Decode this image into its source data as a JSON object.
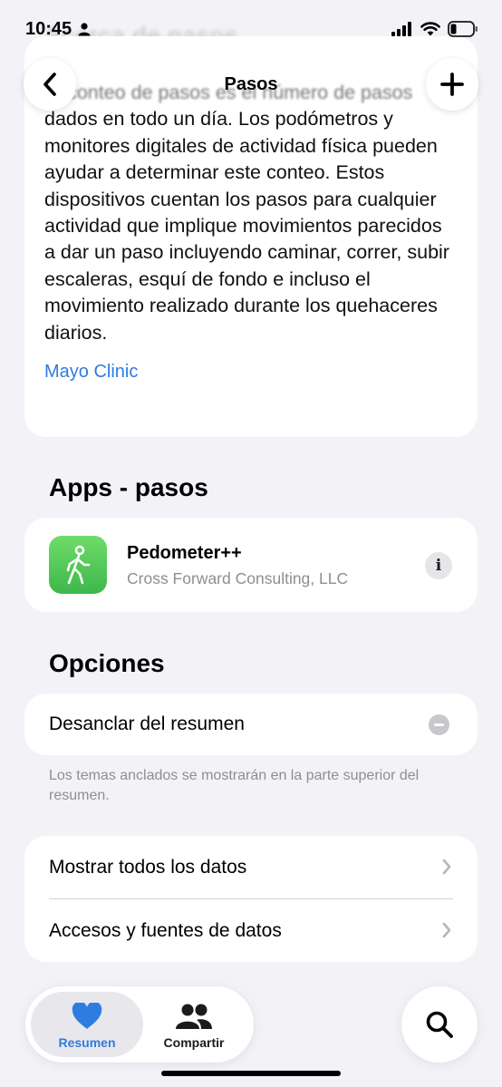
{
  "status_bar": {
    "time": "10:45"
  },
  "nav": {
    "title": "Pasos"
  },
  "about": {
    "ghost_title": "Acerca de pasos",
    "blurred_line": "El conteo de pasos es el número de pasos",
    "body": "dados en todo un día. Los podómetros y monitores digitales de actividad física pueden ayudar a determinar este conteo. Estos dispositivos cuentan los pasos para cualquier actividad que implique movimientos parecidos a dar un paso incluyendo caminar, correr, subir escaleras, esquí de fondo e incluso el movimiento realizado durante los quehaceres diarios.",
    "source": "Mayo Clinic"
  },
  "apps": {
    "title": "Apps - pasos",
    "items": [
      {
        "name": "Pedometer++",
        "developer": "Cross Forward Consulting, LLC"
      }
    ]
  },
  "options": {
    "title": "Opciones",
    "unpin_label": "Desanclar del resumen",
    "footnote": "Los temas anclados se mostrarán en la parte superior del resumen.",
    "rows": [
      "Mostrar todos los datos",
      "Accesos y fuentes de datos"
    ]
  },
  "tabs": {
    "summary": "Resumen",
    "share": "Compartir"
  },
  "colors": {
    "accent": "#2f7ce0",
    "app_icon_green": "#4cc35a",
    "background": "#f2f2f7"
  },
  "icons": {
    "back": "chevron-left-icon",
    "add": "plus-icon",
    "info": "info-icon",
    "unpin": "minus-circle-icon",
    "row_chevron": "chevron-right-icon",
    "summary_tab": "heart-icon",
    "share_tab": "people-icon",
    "search": "search-icon",
    "app": "walking-person-icon"
  }
}
